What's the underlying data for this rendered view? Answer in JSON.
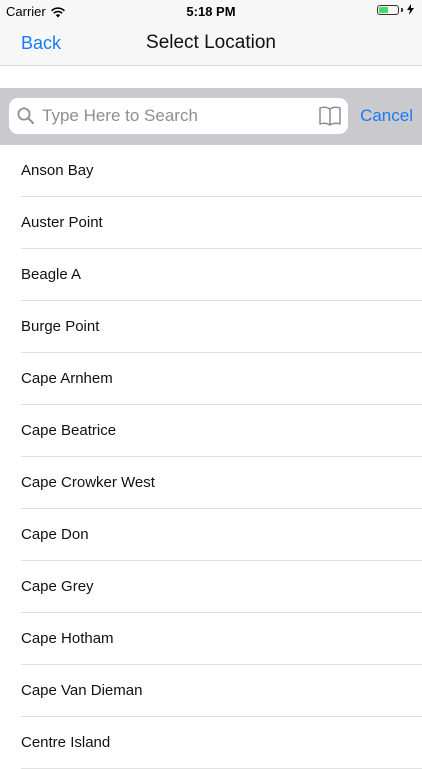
{
  "status_bar": {
    "carrier": "Carrier",
    "time": "5:18 PM",
    "battery_level": 0.55
  },
  "nav": {
    "back_label": "Back",
    "title": "Select Location"
  },
  "search": {
    "placeholder": "Type Here to Search",
    "cancel_label": "Cancel"
  },
  "locations": [
    "Anson Bay",
    "Auster Point",
    "Beagle A",
    "Burge Point",
    "Cape Arnhem",
    "Cape Beatrice",
    "Cape Crowker West",
    "Cape Don",
    "Cape Grey",
    "Cape Hotham",
    "Cape Van Dieman",
    "Centre Island"
  ],
  "colors": {
    "accent": "#1a7cf5",
    "search_bar_bg": "#c9c9ce",
    "battery": "#4cd964"
  }
}
